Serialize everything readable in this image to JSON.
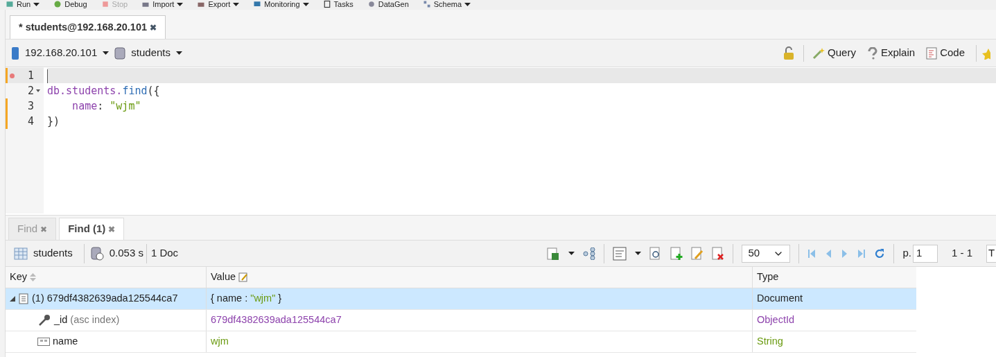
{
  "main_toolbar": [
    {
      "label": "Run",
      "dropdown": true,
      "disabled": false
    },
    {
      "label": "Debug",
      "dropdown": false,
      "disabled": false
    },
    {
      "label": "Stop",
      "dropdown": false,
      "disabled": true
    },
    {
      "label": "Import",
      "dropdown": true,
      "disabled": false
    },
    {
      "label": "Export",
      "dropdown": true,
      "disabled": false
    },
    {
      "label": "Monitoring",
      "dropdown": true,
      "disabled": false
    },
    {
      "label": "Tasks",
      "dropdown": false,
      "disabled": false
    },
    {
      "label": "DataGen",
      "dropdown": false,
      "disabled": false
    },
    {
      "label": "Schema",
      "dropdown": true,
      "disabled": false
    }
  ],
  "editor_tabs": [
    {
      "label": "* students@192.168.20.101",
      "close": "✖",
      "selected": true
    }
  ],
  "connection_bar": {
    "server": "192.168.20.101",
    "database": "students",
    "actions": [
      {
        "label": "Query"
      },
      {
        "label": "Explain"
      },
      {
        "label": "Code"
      }
    ]
  },
  "editor": {
    "lines": [
      {
        "number": "1",
        "breakpoint": true,
        "current": true,
        "modified": true,
        "foldable": false
      },
      {
        "number": "2",
        "breakpoint": false,
        "current": false,
        "modified": false,
        "foldable": true,
        "tokens": [
          {
            "text": "db.students.",
            "kind": "identifier"
          },
          {
            "text": "find",
            "kind": "function"
          },
          {
            "text": "({",
            "kind": "punct"
          }
        ]
      },
      {
        "number": "3",
        "breakpoint": false,
        "current": false,
        "modified": true,
        "foldable": false,
        "tokens": [
          {
            "text": "    name",
            "kind": "identifier"
          },
          {
            "text": ": ",
            "kind": "punct"
          },
          {
            "text": "\"wjm\"",
            "kind": "string"
          }
        ]
      },
      {
        "number": "4",
        "breakpoint": false,
        "current": false,
        "modified": true,
        "foldable": false,
        "tokens": [
          {
            "text": "})",
            "kind": "punct"
          }
        ]
      }
    ]
  },
  "result_tabs": [
    {
      "label": "Find",
      "close": "✖",
      "selected": false
    },
    {
      "label": "Find (1)",
      "close": "✖",
      "selected": true
    }
  ],
  "result_toolbar": {
    "collection": "students",
    "time": "0.053 s",
    "count": "1 Doc",
    "page_size": "50",
    "page_label": "p.",
    "page": "1",
    "range": "1 - 1",
    "cut_field": "T"
  },
  "table": {
    "columns": [
      "Key",
      "Value",
      "Type"
    ],
    "rows": [
      {
        "kind": "document",
        "key": "(1) 679df4382639ada125544ca7",
        "expanded": true,
        "selected": true,
        "value": [
          {
            "text": "{ name : ",
            "kind": "plain"
          },
          {
            "text": "\"wjm\"",
            "kind": "string"
          },
          {
            "text": " }",
            "kind": "plain"
          }
        ],
        "type": "Document",
        "children": [
          {
            "kind": "objectid",
            "key": "_id",
            "note": "(asc index)",
            "selected": false,
            "value": [
              {
                "text": "679df4382639ada125544ca7",
                "kind": "objectid"
              }
            ],
            "type": "ObjectId"
          },
          {
            "kind": "string",
            "key": "name",
            "selected": false,
            "value": [
              {
                "text": "wjm",
                "kind": "string"
              }
            ],
            "type": "String"
          }
        ]
      }
    ]
  }
}
